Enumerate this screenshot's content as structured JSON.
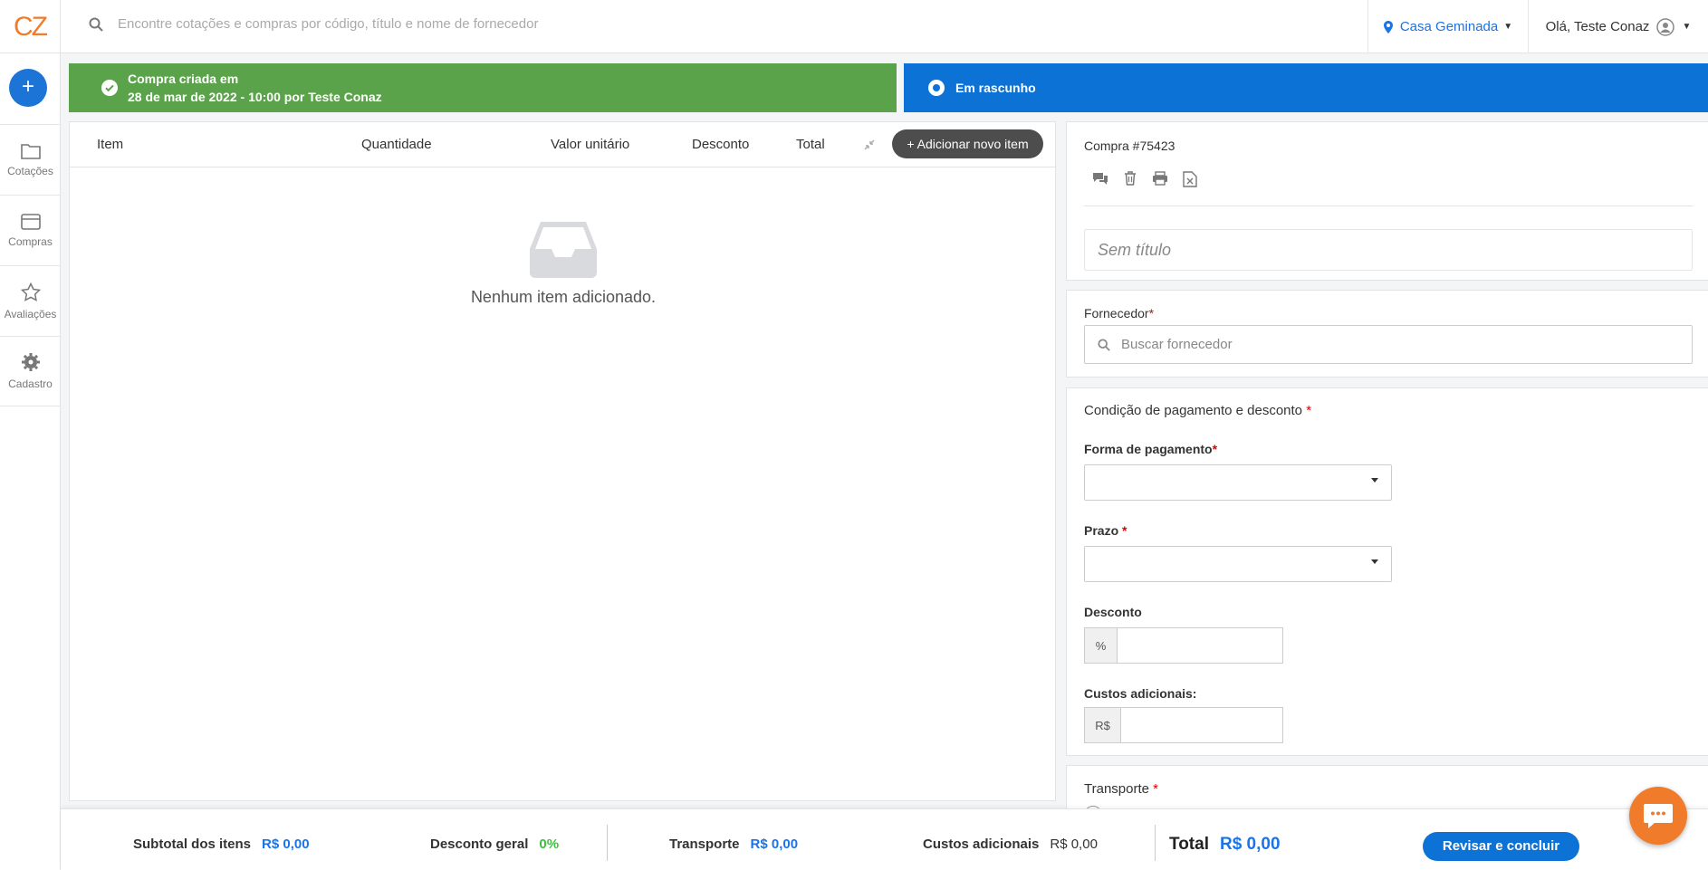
{
  "header": {
    "logo": "CZ",
    "search_placeholder": "Encontre cotações e compras por código, título e nome de fornecedor",
    "location": "Casa Geminada",
    "greeting": "Olá, Teste Conaz"
  },
  "sidebar": {
    "items": [
      {
        "label": "Cotações",
        "icon": "folder-icon"
      },
      {
        "label": "Compras",
        "icon": "card-icon"
      },
      {
        "label": "Avaliações",
        "icon": "star-icon"
      },
      {
        "label": "Cadastro",
        "icon": "gear-icon"
      }
    ]
  },
  "status": {
    "created_line1": "Compra criada em",
    "created_line2": "28 de mar de 2022 - 10:00 por Teste Conaz",
    "current": "Em rascunho"
  },
  "items_table": {
    "columns": [
      "Item",
      "Quantidade",
      "Valor unitário",
      "Desconto",
      "Total"
    ],
    "add_button": "+ Adicionar novo item",
    "empty_message": "Nenhum item adicionado."
  },
  "purchase": {
    "number": "Compra #75423",
    "title_placeholder": "Sem título",
    "supplier_label": "Fornecedor",
    "supplier_placeholder": "Buscar fornecedor",
    "payment_section": "Condição de pagamento e desconto",
    "payment_method_label": "Forma de pagamento",
    "term_label": "Prazo",
    "discount_label": "Desconto",
    "discount_prefix": "%",
    "additional_costs_label": "Custos adicionais:",
    "additional_costs_prefix": "R$",
    "transport_label": "Transporte",
    "required_mark": "*"
  },
  "footer": {
    "subtotal_label": "Subtotal dos itens",
    "subtotal_value": "R$ 0,00",
    "discount_label": "Desconto geral",
    "discount_value": "0%",
    "transport_label": "Transporte",
    "transport_value": "R$ 0,00",
    "costs_label": "Custos adicionais",
    "costs_value": "R$ 0,00",
    "total_label": "Total",
    "total_value": "R$ 0,00",
    "review_button": "Revisar e concluir"
  },
  "colors": {
    "brand_orange": "#f07b2a",
    "primary_blue": "#0d72d6",
    "success_green": "#5aa34a"
  }
}
